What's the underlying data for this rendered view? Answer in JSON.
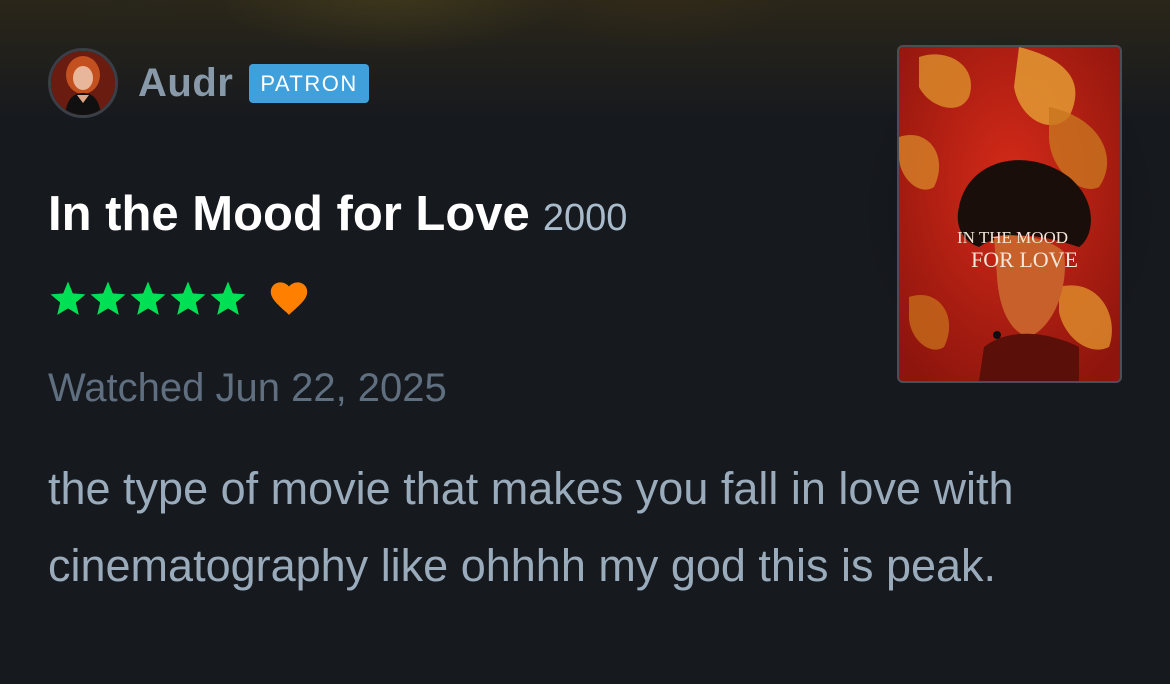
{
  "author": {
    "name": "Audr",
    "badge": "PATRON",
    "avatar_icon": "profile-photo"
  },
  "film": {
    "title": "In the Mood for Love",
    "year": "2000",
    "poster_title_line1": "IN THE MOOD",
    "poster_title_line2": "FOR LOVE"
  },
  "rating": {
    "stars": 5,
    "max_stars": 5,
    "liked": true,
    "star_color": "#00e054",
    "heart_color": "#ff8000"
  },
  "watched_date": "Watched Jun 22, 2025",
  "review_text": "the type of movie that makes you fall in love with cinematography like ohhhh my god this is peak.",
  "colors": {
    "background": "#16191e",
    "badge": "#40a0dc",
    "title": "#ffffff",
    "muted": "#5f6f80",
    "body_text": "#9aabbc"
  }
}
